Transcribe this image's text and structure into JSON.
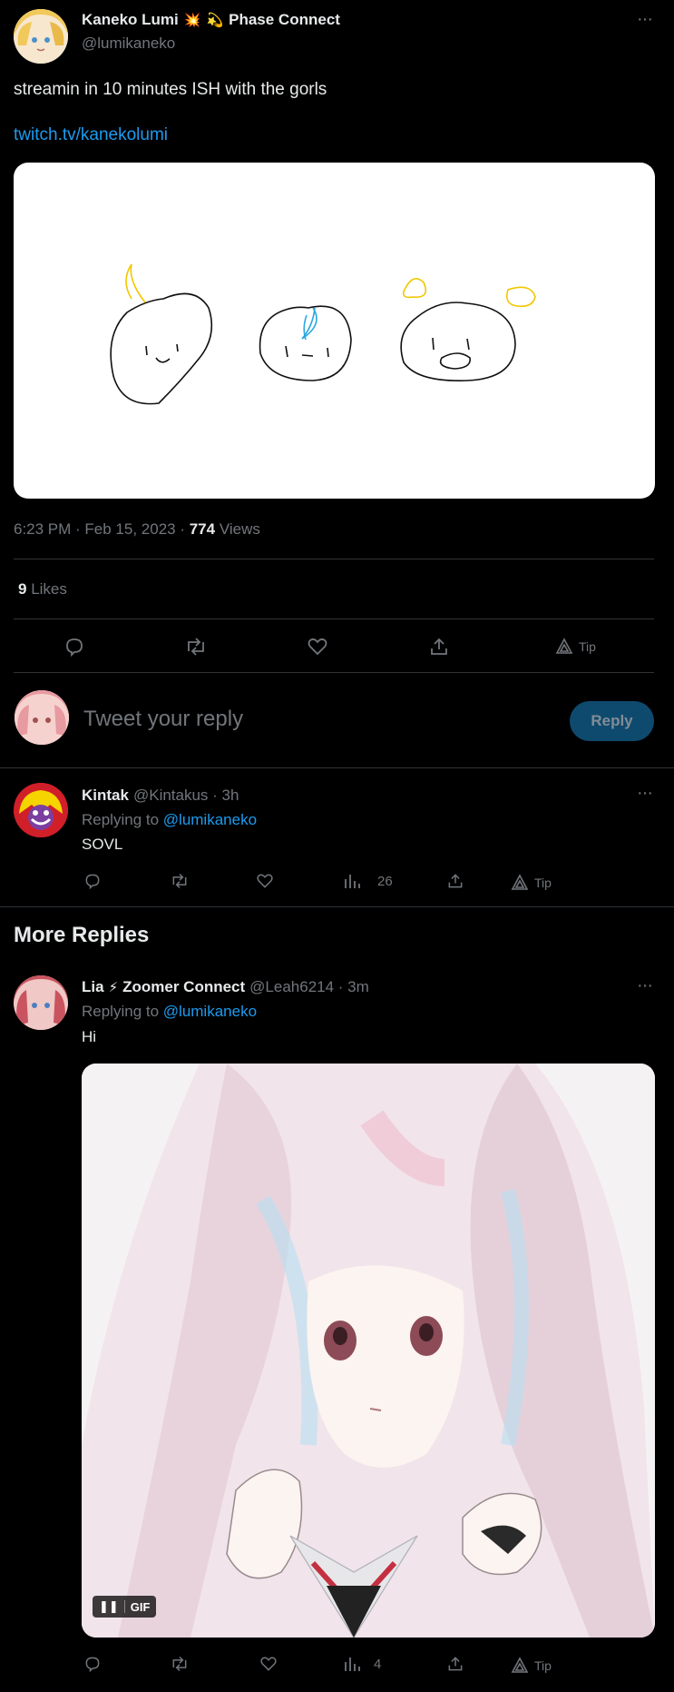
{
  "main_tweet": {
    "author_name": "Kaneko Lumi",
    "author_badge_text": "Phase Connect",
    "handle": "@lumikaneko",
    "text": "streamin in 10 minutes ISH with the gorls",
    "link": "twitch.tv/kanekolumi",
    "meta_time": "6:23 PM · Feb 15, 2023 · ",
    "views_count": "774",
    "views_label": " Views",
    "likes_count": "9",
    "likes_label": " Likes",
    "tip_label": "Tip"
  },
  "reply_box": {
    "placeholder": "Tweet your reply",
    "button": "Reply"
  },
  "reply1": {
    "author_name": "Kintak",
    "handle_time": "@Kintakus · 3h",
    "replying_prefix": "Replying to ",
    "replying_to": "@lumikaneko",
    "text": "SOVL",
    "views": "26",
    "tip_label": "Tip"
  },
  "more_replies_heading": "More Replies",
  "reply2": {
    "author_name": "Lia",
    "author_badge_text": "Zoomer Connect",
    "handle_time": "@Leah6214 · 3m",
    "replying_prefix": "Replying to ",
    "replying_to": "@lumikaneko",
    "text": "Hi",
    "gif_label": "GIF",
    "views": "4",
    "tip_label": "Tip"
  },
  "colors": {
    "accent": "#1d9bf0",
    "reply_button_bg": "#0e4a6e",
    "divider": "#2f3336",
    "muted": "#71767b"
  }
}
